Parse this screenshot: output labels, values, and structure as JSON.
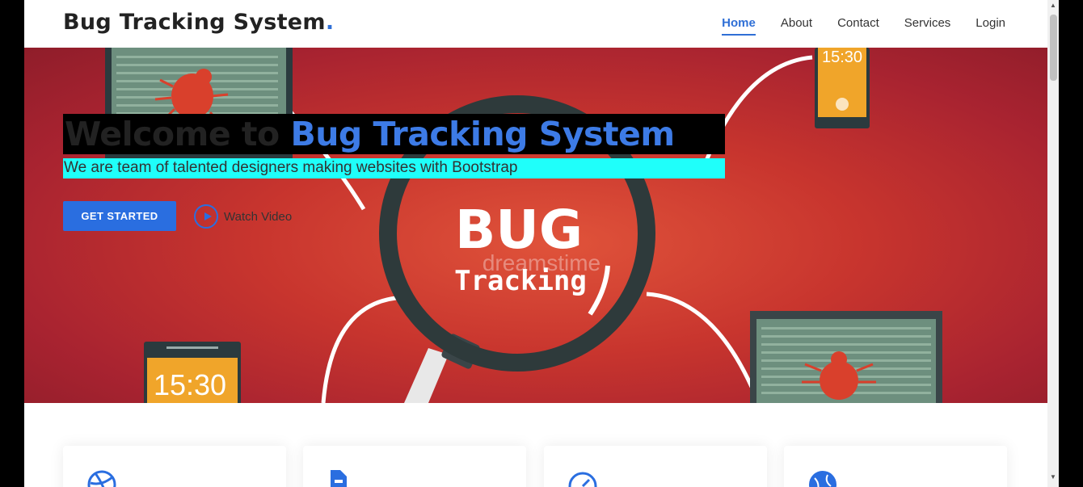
{
  "header": {
    "logo_text": "Bug Tracking System",
    "logo_dot": ".",
    "nav": [
      {
        "label": "Home",
        "active": true
      },
      {
        "label": "About",
        "active": false
      },
      {
        "label": "Contact",
        "active": false
      },
      {
        "label": "Services",
        "active": false
      },
      {
        "label": "Login",
        "active": false
      }
    ]
  },
  "hero": {
    "title_prefix": "Welcome to ",
    "title_accent": "Bug Tracking System",
    "subtitle": "We are team of talented designers making websites with Bootstrap",
    "cta_label": "GET STARTED",
    "watch_label": "Watch Video",
    "illustration": {
      "big_text": "BUG",
      "tracking_text": "Tracking",
      "watermark": "dreamstime",
      "phone_time": "15:30"
    }
  },
  "feature_cards": [
    {
      "icon": "dribbble-icon"
    },
    {
      "icon": "file-icon"
    },
    {
      "icon": "speedometer-icon"
    },
    {
      "icon": "globe-icon"
    }
  ],
  "colors": {
    "accent": "#2f6fd6",
    "hero_red": "#c8352e",
    "subtitle_highlight": "#1ffffa"
  }
}
